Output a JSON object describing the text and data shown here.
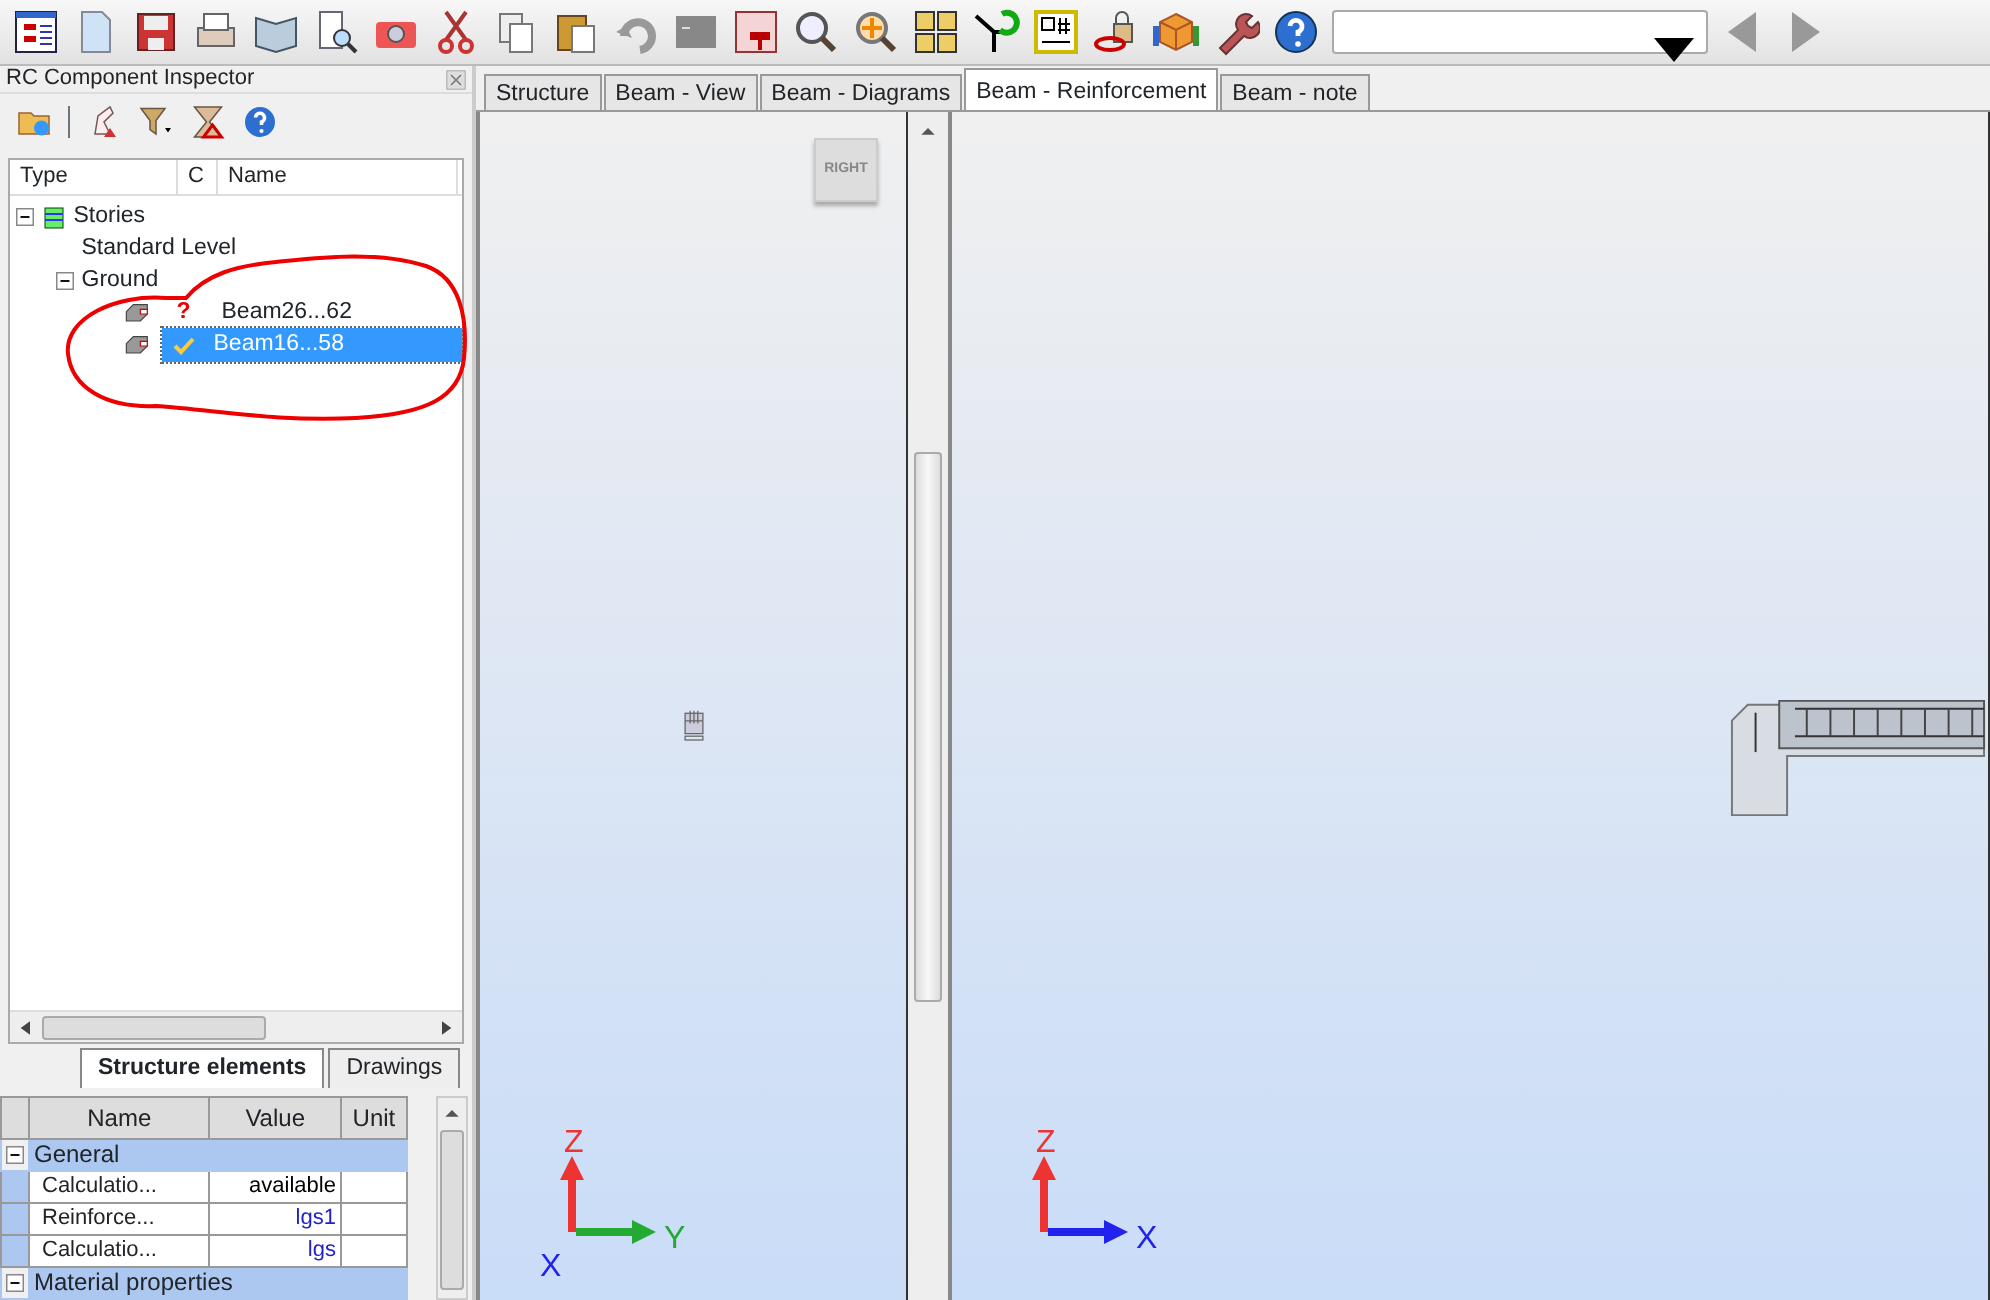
{
  "inspector": {
    "title": "RC Component Inspector",
    "tree_columns": [
      "Type",
      "C",
      "Name"
    ],
    "tree": [
      {
        "label": "Stories",
        "kind": "stories",
        "expanded": true,
        "children": [
          {
            "label": "Standard Level"
          },
          {
            "label": "Ground",
            "expanded": true,
            "children": [
              {
                "label": "Beam26...62",
                "kind": "beam",
                "checked": false,
                "status": "?",
                "selected": false
              },
              {
                "label": "Beam16...58",
                "kind": "beam",
                "checked": true,
                "selected": true
              }
            ]
          }
        ]
      }
    ],
    "tabs": [
      {
        "label": "Structure elements",
        "selected": true
      },
      {
        "label": "Drawings",
        "selected": false
      }
    ]
  },
  "properties": {
    "columns": [
      "Name",
      "Value",
      "Unit"
    ],
    "groups": [
      {
        "name": "General",
        "expanded": true,
        "rows": [
          {
            "name": "Calculatio...",
            "value": "available",
            "linked": false
          },
          {
            "name": "Reinforce...",
            "value": "lgs1",
            "linked": true
          },
          {
            "name": "Calculatio...",
            "value": "lgs",
            "linked": true
          }
        ]
      },
      {
        "name": "Material properties",
        "expanded": true
      }
    ]
  },
  "document_tabs": [
    {
      "label": "Structure",
      "selected": false
    },
    {
      "label": "Beam - View",
      "selected": false
    },
    {
      "label": "Beam - Diagrams",
      "selected": false
    },
    {
      "label": "Beam - Reinforcement",
      "selected": true
    },
    {
      "label": "Beam - note",
      "selected": false
    }
  ],
  "viewports": [
    {
      "kind": "section",
      "view_cube": "RIGHT",
      "axes": [
        {
          "label": "Z",
          "kind": "up",
          "color": "#ee3333"
        },
        {
          "label": "X",
          "kind": "toward",
          "color": "#2222ee"
        },
        {
          "label": "Y",
          "kind": "right",
          "color": "#22aa33"
        }
      ]
    },
    {
      "kind": "beam3d",
      "axes": [
        {
          "label": "Z",
          "kind": "up",
          "color": "#ee3333"
        },
        {
          "label": "X",
          "kind": "right",
          "color": "#2222ee"
        }
      ]
    }
  ]
}
